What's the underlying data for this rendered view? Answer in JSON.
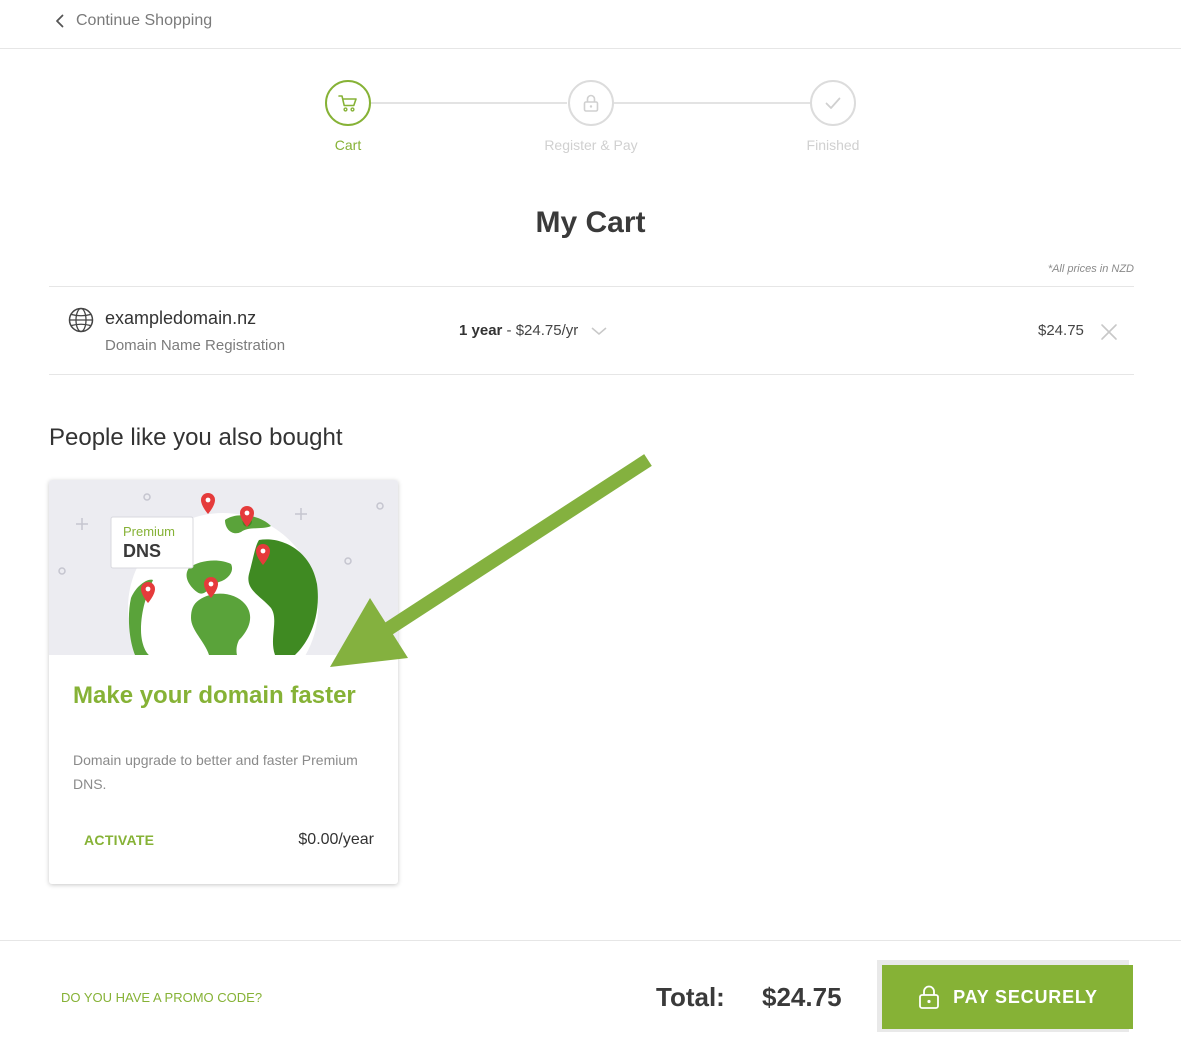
{
  "header": {
    "back_label": "Continue Shopping"
  },
  "stepper": {
    "steps": [
      {
        "label": "Cart",
        "icon": "cart-icon",
        "active": true
      },
      {
        "label": "Register & Pay",
        "icon": "lock-icon",
        "active": false
      },
      {
        "label": "Finished",
        "icon": "check-icon",
        "active": false
      }
    ]
  },
  "cart": {
    "title": "My Cart",
    "price_note": "*All prices in NZD",
    "items": [
      {
        "domain": "exampledomain.nz",
        "type": "Domain Name Registration",
        "term_bold": "1 year",
        "term_rest": " - $24.75/yr",
        "price": "$24.75"
      }
    ]
  },
  "upsell": {
    "section_title": "People like you also bought",
    "card": {
      "badge_small": "Premium",
      "badge_big": "DNS",
      "title": "Make your domain faster",
      "description": "Domain upgrade to better and faster Premium DNS.",
      "action_label": "ACTIVATE",
      "price": "$0.00/year"
    }
  },
  "footer": {
    "promo_label": "DO YOU HAVE A PROMO CODE?",
    "total_label": "Total:",
    "total_value": "$24.75",
    "pay_label": "PAY SECURELY"
  },
  "colors": {
    "accent": "#86b236",
    "arrow": "#84b13f",
    "muted_step": "#d0d0d0",
    "globe_green": "#4f9a2a",
    "pin_red": "#e53b3b"
  }
}
